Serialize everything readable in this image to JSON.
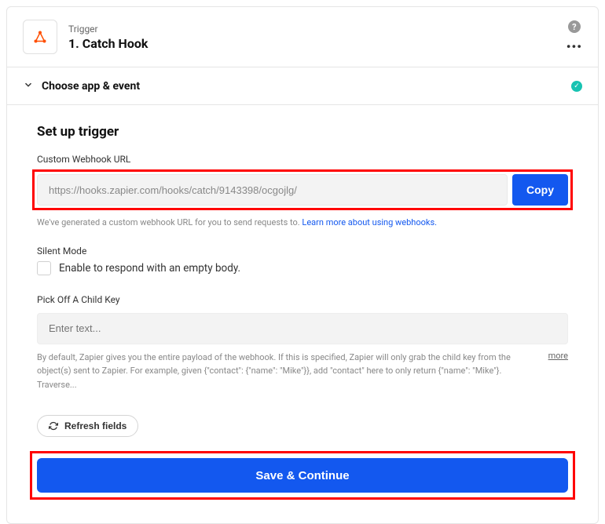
{
  "header": {
    "type_label": "Trigger",
    "title": "1. Catch Hook"
  },
  "section": {
    "title": "Choose app & event"
  },
  "setup": {
    "heading": "Set up trigger",
    "webhook": {
      "label": "Custom Webhook URL",
      "value": "https://hooks.zapier.com/hooks/catch/9143398/ocgojlg/",
      "copy_label": "Copy",
      "helper_pre": "We've generated a custom webhook URL for you to send requests to. ",
      "helper_link": "Learn more about using webhooks."
    },
    "silent": {
      "label": "Silent Mode",
      "checkbox_label": "Enable to respond with an empty body."
    },
    "child_key": {
      "label": "Pick Off A Child Key",
      "placeholder": "Enter text...",
      "description": "By default, Zapier gives you the entire payload of the webhook. If this is specified, Zapier will only grab the child key from the object(s) sent to Zapier. For example, given {\"contact\": {\"name\": \"Mike\"}}, add \"contact\" here to only return {\"name\": \"Mike\"}. Traverse...",
      "more_label": "more"
    },
    "refresh_label": "Refresh fields",
    "save_label": "Save & Continue"
  }
}
